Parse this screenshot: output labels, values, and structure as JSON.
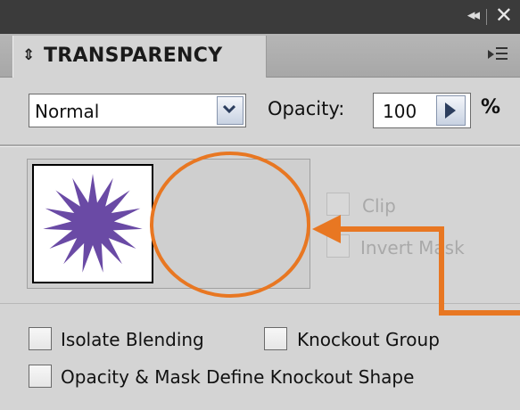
{
  "panel": {
    "title": "TRANSPARENCY",
    "blend_mode": {
      "selected": "Normal"
    },
    "opacity": {
      "label": "Opacity:",
      "value": "100",
      "unit": "%"
    },
    "mask_options": {
      "clip_label": "Clip",
      "invert_label": "Invert Mask",
      "enabled": false
    },
    "options": {
      "isolate_blending": "Isolate Blending",
      "knockout_group": "Knockout Group",
      "opacity_mask_knockout": "Opacity & Mask Define Knockout Shape"
    }
  },
  "art_thumbnail": {
    "shape": "starburst",
    "fill": "#6a4aa5"
  },
  "annotation": {
    "color": "#e87722",
    "shapes": [
      "circle",
      "elbow-arrow"
    ]
  },
  "icons": [
    "collapse-icon",
    "close-icon",
    "panel-menu-icon",
    "tab-arrows-icon",
    "dropdown-chevron-icon",
    "stepper-arrow-icon"
  ]
}
